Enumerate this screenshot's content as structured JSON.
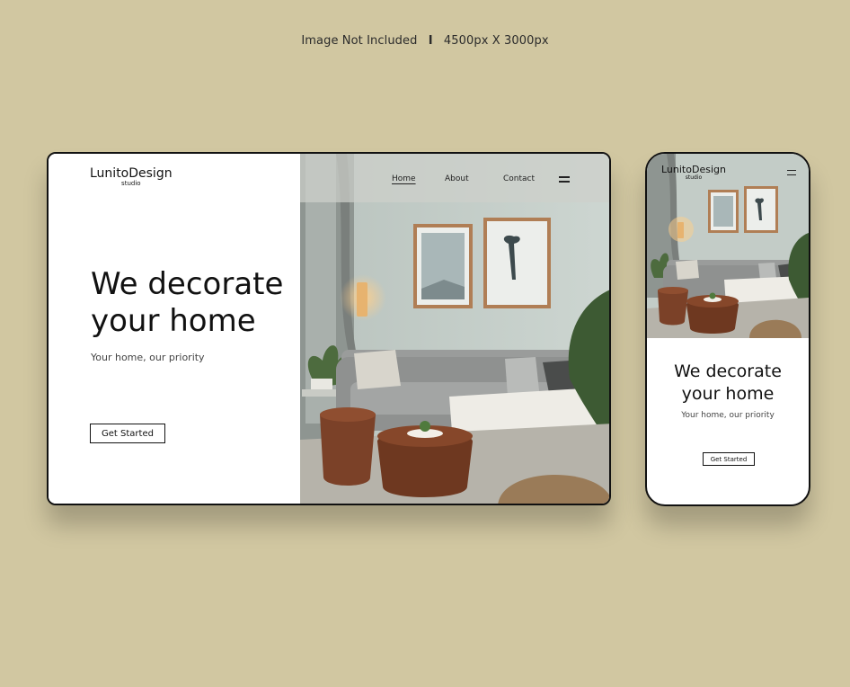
{
  "caption": {
    "label": "Image Not Included",
    "separator": "I",
    "dims": "4500px X 3000px"
  },
  "desktop": {
    "logo": {
      "name": "LunitoDesign",
      "sub": "studio"
    },
    "nav": [
      {
        "label": "Home",
        "active": true
      },
      {
        "label": "About",
        "active": false
      },
      {
        "label": "Contact",
        "active": false
      }
    ],
    "menu_icon": "hamburger-menu-icon",
    "hero": {
      "line1": "We decorate",
      "line2": "your home",
      "subtitle": "Your home, our priority",
      "cta": "Get Started"
    }
  },
  "mobile": {
    "logo": {
      "name": "LunitoDesign",
      "sub": "studio"
    },
    "menu_icon": "hamburger-menu-icon",
    "hero": {
      "line1": "We decorate",
      "line2": "your home",
      "subtitle": "Your home, our priority",
      "cta": "Get Started"
    }
  },
  "colors": {
    "background": "#d1c7a1",
    "frame": "#111111",
    "wall": "#c7d0cb",
    "sofa": "#8f9190",
    "wood": "#7b4128"
  }
}
